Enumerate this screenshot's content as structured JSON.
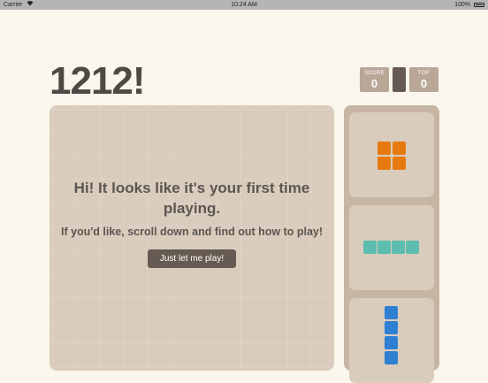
{
  "status_bar": {
    "carrier": "Carrier",
    "time": "10:24 AM",
    "battery": "100%"
  },
  "game": {
    "title": "1212!",
    "score": {
      "label": "SCORE",
      "value": "0"
    },
    "top": {
      "label": "TOP",
      "value": "0"
    }
  },
  "board": {
    "message_title": "Hi! It looks like it's your first time playing.",
    "message_sub": "If you'd like, scroll down and find out how to play!",
    "play_button": "Just let me play!"
  },
  "pieces": [
    {
      "name": "square-2x2",
      "color": "#e8790f"
    },
    {
      "name": "line-horizontal-4",
      "color": "#5cbdb0"
    },
    {
      "name": "line-vertical",
      "color": "#2f7fd3"
    }
  ],
  "colors": {
    "background": "#faf6ec",
    "board": "#d9ccbd",
    "tray": "#c5b5a2",
    "dark": "#655b53"
  }
}
